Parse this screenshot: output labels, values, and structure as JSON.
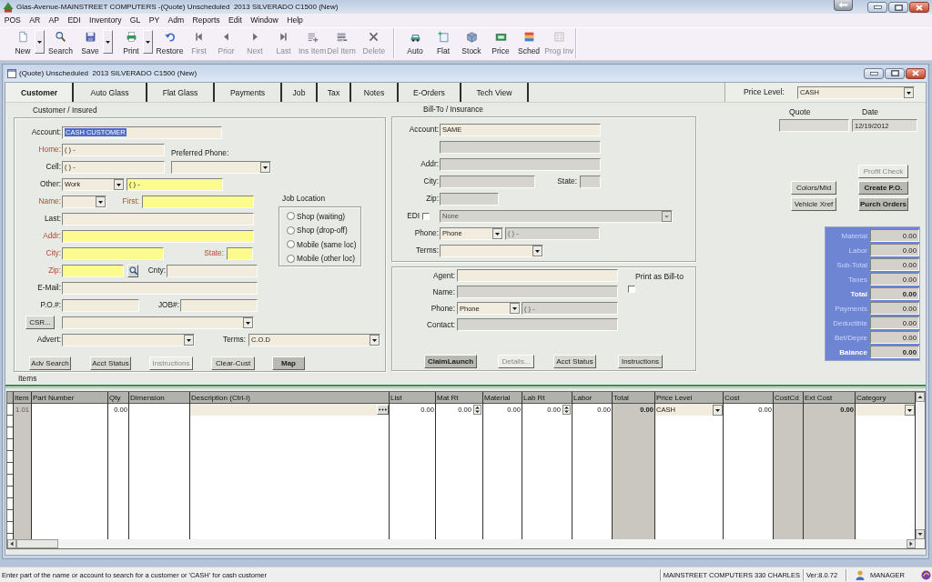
{
  "window": {
    "title": "Glas-Avenue-MAINSTREET COMPUTERS -(Quote) Unscheduled  2013 SILVERADO C1500 (New)"
  },
  "menu": [
    "POS",
    "AR",
    "AP",
    "EDI",
    "Inventory",
    "GL",
    "PY",
    "Adm",
    "Reports",
    "Edit",
    "Window",
    "Help"
  ],
  "toolbar": [
    [
      {
        "label": "New",
        "has_menu": true,
        "disabled": false
      },
      {
        "label": "Search",
        "has_menu": false,
        "disabled": false
      },
      {
        "label": "Save",
        "has_menu": true,
        "disabled": false
      },
      {
        "label": "Print",
        "has_menu": true,
        "disabled": false
      },
      {
        "label": "Restore",
        "has_menu": false,
        "disabled": false
      },
      {
        "label": "First",
        "has_menu": false,
        "disabled": true
      },
      {
        "label": "Prior",
        "has_menu": false,
        "disabled": true
      },
      {
        "label": "Next",
        "has_menu": false,
        "disabled": true
      },
      {
        "label": "Last",
        "has_menu": false,
        "disabled": true
      },
      {
        "label": "Ins Item",
        "has_menu": false,
        "disabled": true
      },
      {
        "label": "Del Item",
        "has_menu": false,
        "disabled": true
      },
      {
        "label": "Delete",
        "has_menu": false,
        "disabled": true
      }
    ],
    [
      {
        "label": "Auto",
        "has_menu": false,
        "disabled": false
      },
      {
        "label": "Flat",
        "has_menu": false,
        "disabled": false
      },
      {
        "label": "Stock",
        "has_menu": false,
        "disabled": false
      },
      {
        "label": "Price",
        "has_menu": false,
        "disabled": false
      },
      {
        "label": "Sched",
        "has_menu": false,
        "disabled": false
      },
      {
        "label": "Prog Inv",
        "has_menu": false,
        "disabled": true
      }
    ]
  ],
  "document": {
    "title": "(Quote) Unscheduled  2013 SILVERADO C1500 (New)",
    "tabs": [
      {
        "label": "Customer",
        "selected": true
      },
      {
        "label": "Auto Glass",
        "selected": false
      },
      {
        "label": "Flat Glass",
        "selected": false
      },
      {
        "label": "Payments",
        "selected": false
      },
      {
        "label": "Job",
        "selected": false
      },
      {
        "label": "Tax",
        "selected": false
      },
      {
        "label": "Notes",
        "selected": false
      },
      {
        "label": "E-Orders",
        "selected": false
      },
      {
        "label": "Tech View",
        "selected": false
      }
    ],
    "price_level": {
      "label": "Price Level:",
      "value": "CASH"
    },
    "customer": {
      "title": "Customer / Insured",
      "rows": [
        {
          "fields": [
            {
              "kind": "label",
              "text": "Account:",
              "required": false
            },
            {
              "kind": "text",
              "value": "CASH CUSTOMER",
              "focused": true,
              "required": false,
              "disabled": false
            }
          ]
        },
        {
          "fields": [
            {
              "kind": "label",
              "text": "Home:",
              "required": true
            },
            {
              "kind": "text",
              "value": "( ) -",
              "focused": false,
              "required": false,
              "disabled": false
            },
            {
              "kind": "label",
              "text": "Preferred Phone:",
              "required": false
            }
          ]
        },
        {
          "fields": [
            {
              "kind": "label",
              "text": "Cell:",
              "required": false
            },
            {
              "kind": "text",
              "value": "( ) -",
              "focused": false,
              "required": false,
              "disabled": false
            },
            {
              "kind": "dropdown",
              "required": false,
              "disabled": false
            }
          ]
        },
        {
          "fields": [
            {
              "kind": "label",
              "text": "Other:",
              "required": false
            },
            {
              "kind": "dropdown",
              "value": "Work",
              "required": false,
              "disabled": false
            },
            {
              "kind": "text",
              "value": "( ) -",
              "focused": false,
              "required": true,
              "disabled": false
            }
          ]
        },
        {
          "fields": [
            {
              "kind": "label",
              "text": "Name:",
              "required": true
            },
            {
              "kind": "dropdown",
              "required": false,
              "disabled": false
            },
            {
              "kind": "label",
              "text": "First:",
              "required": true
            },
            {
              "kind": "text",
              "required": true,
              "disabled": false
            }
          ]
        },
        {
          "fields": [
            {
              "kind": "label",
              "text": "Last:",
              "required": false
            },
            {
              "kind": "text",
              "required": false,
              "disabled": false
            }
          ]
        },
        {
          "fields": [
            {
              "kind": "label",
              "text": "Addr:",
              "required": true
            },
            {
              "kind": "text",
              "required": true,
              "disabled": false
            }
          ]
        },
        {
          "fields": [
            {
              "kind": "label",
              "text": "City:",
              "required": true
            },
            {
              "kind": "text",
              "required": true,
              "disabled": false
            },
            {
              "kind": "label",
              "text": "State:",
              "required": true
            },
            {
              "kind": "text",
              "required": true,
              "disabled": false
            }
          ]
        },
        {
          "fields": [
            {
              "kind": "label",
              "text": "Zip:",
              "required": true
            },
            {
              "kind": "text",
              "required": true,
              "disabled": false
            },
            {
              "kind": "lookup"
            },
            {
              "kind": "label",
              "text": "Cnty:",
              "required": false
            },
            {
              "kind": "text",
              "required": false,
              "disabled": false
            }
          ]
        },
        {
          "fields": [
            {
              "kind": "label",
              "text": "E-Mail:",
              "required": false
            },
            {
              "kind": "text",
              "required": false,
              "disabled": false
            }
          ]
        },
        {
          "fields": [
            {
              "kind": "label",
              "text": "P.O.#:",
              "required": false
            },
            {
              "kind": "text",
              "required": false,
              "disabled": false
            },
            {
              "kind": "label",
              "text": "JOB#:",
              "required": false
            },
            {
              "kind": "text",
              "required": false,
              "disabled": false
            }
          ]
        },
        {
          "fields": [
            {
              "kind": "button",
              "label": "CSR...",
              "disabled": false,
              "highlighted": false
            },
            {
              "kind": "dropdown",
              "required": false,
              "disabled": false
            }
          ]
        },
        {
          "fields": [
            {
              "kind": "label",
              "text": "Advert:",
              "required": false
            },
            {
              "kind": "dropdown",
              "required": false,
              "disabled": false
            },
            {
              "kind": "label",
              "text": "Terms:",
              "required": false
            },
            {
              "kind": "dropdown",
              "value": "C.O.D",
              "required": false,
              "disabled": false
            }
          ]
        }
      ],
      "job_location": {
        "title": "Job Location",
        "options": [
          {
            "label": "Shop (waiting)",
            "selected": false
          },
          {
            "label": "Shop (drop-off)",
            "selected": false
          },
          {
            "label": "Mobile (same loc)",
            "selected": false
          },
          {
            "label": "Mobile (other loc)",
            "selected": false
          }
        ]
      },
      "buttons": [
        {
          "label": "Adv Search",
          "disabled": false,
          "highlighted": false
        },
        {
          "label": "Acct Status",
          "disabled": false,
          "highlighted": false
        },
        {
          "label": "Instructions",
          "disabled": true,
          "highlighted": false
        },
        {
          "label": "Clear-Cust",
          "disabled": false,
          "highlighted": false
        },
        {
          "label": "Map",
          "disabled": false,
          "highlighted": true
        }
      ]
    },
    "bill_to": {
      "title": "Bill-To / Insurance",
      "rows": [
        {
          "fields": [
            {
              "kind": "label",
              "text": "Account:",
              "required": false
            },
            {
              "kind": "text",
              "value": "SAME",
              "focused": false,
              "required": false,
              "disabled": false
            }
          ]
        },
        {
          "fields": [
            {
              "kind": "text",
              "required": false,
              "disabled": true
            }
          ]
        },
        {
          "fields": [
            {
              "kind": "label",
              "text": "Addr:",
              "required": false
            },
            {
              "kind": "text",
              "required": false,
              "disabled": true
            }
          ]
        },
        {
          "fields": [
            {
              "kind": "label",
              "text": "City:",
              "required": false
            },
            {
              "kind": "text",
              "required": false,
              "disabled": true
            },
            {
              "kind": "label",
              "text": "State:",
              "required": false
            },
            {
              "kind": "text",
              "required": false,
              "disabled": true
            }
          ]
        },
        {
          "fields": [
            {
              "kind": "label",
              "text": "Zip:",
              "required": false
            },
            {
              "kind": "text",
              "required": false,
              "disabled": true
            }
          ]
        },
        {
          "fields": [
            {
              "kind": "label",
              "text": "EDI",
              "required": false
            },
            {
              "kind": "checkbox",
              "checked": false
            },
            {
              "kind": "dropdown",
              "value": "None",
              "required": false,
              "disabled": true
            }
          ]
        },
        {
          "fields": [
            {
              "kind": "label",
              "text": "Phone:",
              "required": false
            },
            {
              "kind": "dropdown",
              "value": "Phone",
              "required": false,
              "disabled": false
            },
            {
              "kind": "text",
              "value": "( ) -",
              "focused": false,
              "required": false,
              "disabled": true
            }
          ]
        },
        {
          "fields": [
            {
              "kind": "label",
              "text": "Terms:",
              "required": false
            },
            {
              "kind": "dropdown",
              "required": false,
              "disabled": false
            }
          ]
        }
      ]
    },
    "agent": {
      "rows": [
        {
          "fields": [
            {
              "kind": "label",
              "text": "Agent:",
              "required": false
            },
            {
              "kind": "text",
              "required": false,
              "disabled": false
            }
          ]
        },
        {
          "fields": [
            {
              "kind": "label",
              "text": "Name:",
              "required": false
            },
            {
              "kind": "text",
              "required": false,
              "disabled": true
            }
          ]
        },
        {
          "fields": [
            {
              "kind": "label",
              "text": "Phone:",
              "required": false
            },
            {
              "kind": "dropdown",
              "value": "Phone",
              "required": false,
              "disabled": false
            },
            {
              "kind": "text",
              "value": "( ) -",
              "focused": false,
              "required": false,
              "disabled": true
            }
          ]
        },
        {
          "fields": [
            {
              "kind": "label",
              "text": "Contact:",
              "required": false
            },
            {
              "kind": "text",
              "required": false,
              "disabled": true
            }
          ]
        }
      ],
      "print_as_bill_to": {
        "label": "Print as Bill-to",
        "checked": false
      },
      "buttons": [
        {
          "label": "ClaimLaunch",
          "disabled": false,
          "highlighted": true
        },
        {
          "label": "Details...",
          "disabled": true,
          "highlighted": false
        },
        {
          "label": "Acct Status",
          "disabled": false,
          "highlighted": false
        },
        {
          "label": "Instructions",
          "disabled": false,
          "highlighted": false
        }
      ]
    },
    "quote": {
      "label": "Quote"
    },
    "date": {
      "label": "Date",
      "value": "12/19/2012"
    },
    "actions": [
      {
        "label": "Profit Check",
        "disabled": true,
        "highlighted": false
      },
      {
        "label": "Colors/Mld",
        "disabled": false,
        "highlighted": false
      },
      {
        "label": "Create P.O.",
        "disabled": false,
        "highlighted": true
      },
      {
        "label": "Vehicle Xref",
        "disabled": false,
        "highlighted": false
      },
      {
        "label": "Purch Orders",
        "disabled": false,
        "highlighted": true
      }
    ],
    "totals": [
      {
        "label": "Material",
        "value": "0.00",
        "kind": "line"
      },
      {
        "label": "Labor",
        "value": "0.00",
        "kind": "line"
      },
      {
        "label": "Sub-Total",
        "value": "0.00",
        "kind": "line"
      },
      {
        "label": "Taxes",
        "value": "0.00",
        "kind": "line"
      },
      {
        "label": "Total",
        "value": "0.00",
        "kind": "total"
      },
      {
        "label": "Payments",
        "value": "0.00",
        "kind": "line"
      },
      {
        "label": "Deductible",
        "value": "0.00",
        "kind": "line"
      },
      {
        "label": "Bet/Depre",
        "value": "0.00",
        "kind": "line"
      },
      {
        "label": "Balance",
        "value": "0.00",
        "kind": "total"
      }
    ],
    "items": {
      "title": "Items",
      "columns": [
        {
          "label": "Item",
          "kind": "index"
        },
        {
          "label": "Part Number",
          "kind": "text"
        },
        {
          "label": "Qty",
          "kind": "number"
        },
        {
          "label": "Dimension",
          "kind": "text"
        },
        {
          "label": "Description (Ctrl-I)",
          "kind": "lookup"
        },
        {
          "label": "List",
          "kind": "number"
        },
        {
          "label": "Mat Rt",
          "kind": "spin"
        },
        {
          "label": "Material",
          "kind": "number"
        },
        {
          "label": "Lab Rt",
          "kind": "spin"
        },
        {
          "label": "Labor",
          "kind": "number"
        },
        {
          "label": "Total",
          "kind": "total"
        },
        {
          "label": "Price Level",
          "kind": "dropdown"
        },
        {
          "label": "Cost",
          "kind": "number"
        },
        {
          "label": "CostCd",
          "kind": "locked"
        },
        {
          "label": "Ext Cost",
          "kind": "total"
        },
        {
          "label": "Category",
          "kind": "dropdown"
        }
      ],
      "rows": [
        {
          "cells": [
            "1.01",
            null,
            "0.00",
            null,
            null,
            "0.00",
            "0.00",
            "0.00",
            "0.00",
            "0.00",
            "0.00",
            "CASH",
            "0.00",
            null,
            "0.00",
            null
          ]
        }
      ]
    }
  },
  "status_bar": {
    "message": "Enter part of the name or account to search for a customer or 'CASH' for cash customer",
    "company": "MAINSTREET COMPUTERS 330 CHARLES",
    "version": "Ver:8.0.72",
    "user": "MANAGER"
  }
}
